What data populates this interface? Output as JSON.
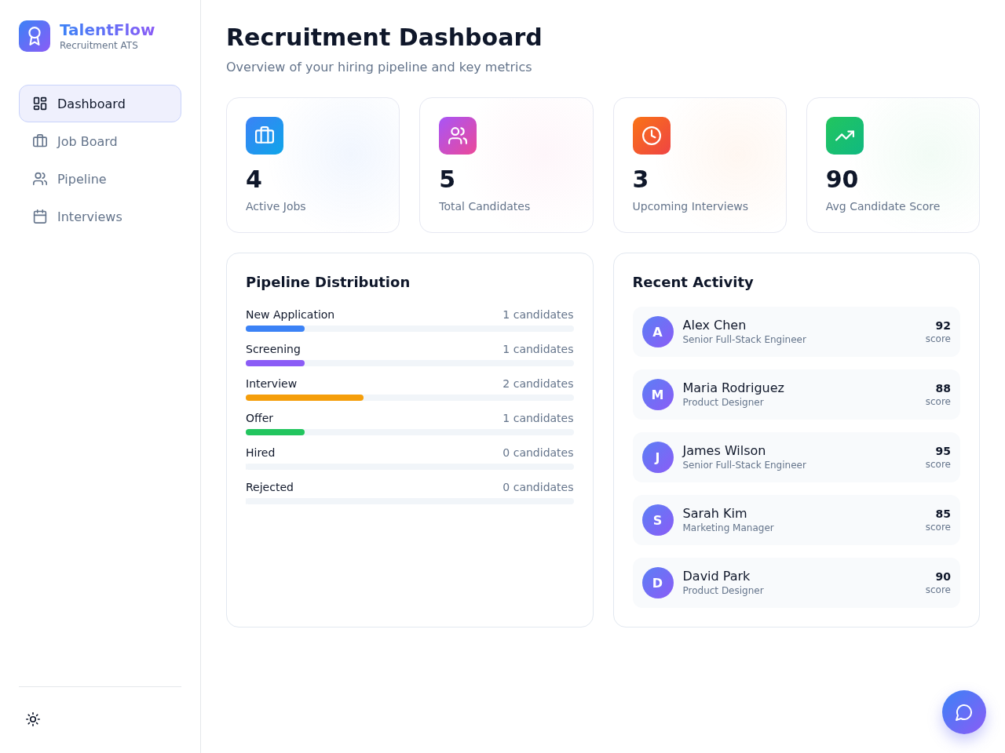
{
  "sidebar": {
    "brand": {
      "name": "TalentFlow",
      "tagline": "Recruitment ATS"
    },
    "nav": [
      {
        "label": "Dashboard",
        "selected": true
      },
      {
        "label": "Job Board",
        "selected": false
      },
      {
        "label": "Pipeline",
        "selected": false
      },
      {
        "label": "Interviews",
        "selected": false
      }
    ]
  },
  "header": {
    "title": "Recruitment Dashboard",
    "subtitle": "Overview of your hiring pipeline and key metrics"
  },
  "stats": [
    {
      "value": "4",
      "label": "Active Jobs"
    },
    {
      "value": "5",
      "label": "Total Candidates"
    },
    {
      "value": "3",
      "label": "Upcoming Interviews"
    },
    {
      "value": "90",
      "label": "Avg Candidate Score"
    }
  ],
  "pipeline": {
    "title": "Pipeline Distribution",
    "stages": [
      {
        "label": "New Application",
        "count": "1 candidates",
        "level": 0.18,
        "color": "#3b82f6"
      },
      {
        "label": "Screening",
        "count": "1 candidates",
        "level": 0.18,
        "color": "#8b5cf6"
      },
      {
        "label": "Interview",
        "count": "2 candidates",
        "level": 0.36,
        "color": "#f59e0b"
      },
      {
        "label": "Offer",
        "count": "1 candidates",
        "level": 0.18,
        "color": "#22c55e"
      },
      {
        "label": "Hired",
        "count": "0 candidates",
        "level": 0
      },
      {
        "label": "Rejected",
        "count": "0 candidates",
        "level": 0
      }
    ]
  },
  "activity": {
    "title": "Recent Activity",
    "items": [
      {
        "initial": "A",
        "name": "Alex Chen",
        "role": "Senior Full-Stack Engineer",
        "score": "92",
        "score_label": "score"
      },
      {
        "initial": "M",
        "name": "Maria Rodriguez",
        "role": "Product Designer",
        "score": "88",
        "score_label": "score"
      },
      {
        "initial": "J",
        "name": "James Wilson",
        "role": "Senior Full-Stack Engineer",
        "score": "95",
        "score_label": "score"
      },
      {
        "initial": "S",
        "name": "Sarah Kim",
        "role": "Marketing Manager",
        "score": "85",
        "score_label": "score"
      },
      {
        "initial": "D",
        "name": "David Park",
        "role": "Product Designer",
        "score": "90",
        "score_label": "score"
      }
    ]
  }
}
